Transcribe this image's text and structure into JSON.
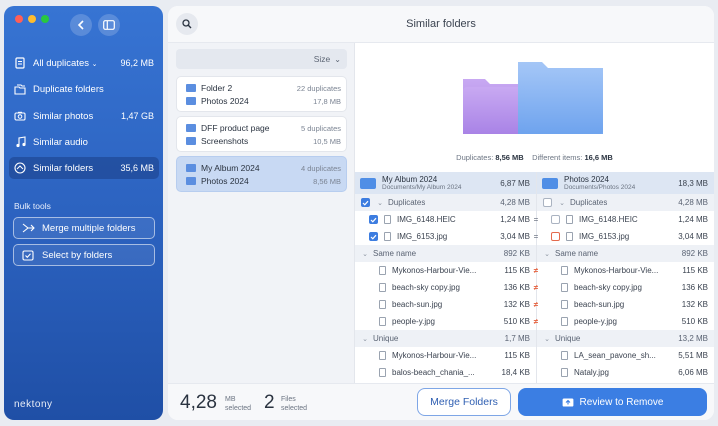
{
  "sidebar": {
    "items": [
      {
        "label": "All duplicates",
        "size": "96,2 MB",
        "icon": "files-icon"
      },
      {
        "label": "Duplicate folders",
        "size": "",
        "icon": "folders-icon"
      },
      {
        "label": "Similar photos",
        "size": "1,47 GB",
        "icon": "camera-icon"
      },
      {
        "label": "Similar audio",
        "size": "",
        "icon": "music-icon"
      },
      {
        "label": "Similar folders",
        "size": "35,6 MB",
        "icon": "similar-folders-icon"
      }
    ],
    "bulk_label": "Bulk tools",
    "merge_multiple": "Merge multiple folders",
    "select_by_folders": "Select by folders",
    "brand": "nektony"
  },
  "header": {
    "title": "Similar folders"
  },
  "list": {
    "sort_label": "Size",
    "cards": [
      {
        "top": "Folder 2",
        "top_meta": "22 duplicates",
        "bottom": "Photos 2024",
        "bottom_meta": "17,8 MB"
      },
      {
        "top": "DFF product page",
        "top_meta": "5 duplicates",
        "bottom": "Screenshots",
        "bottom_meta": "10,5 MB"
      },
      {
        "top": "My Album 2024",
        "top_meta": "4 duplicates",
        "bottom": "Photos 2024",
        "bottom_meta": "8,56 MB"
      }
    ]
  },
  "preview": {
    "duplicates_label": "Duplicates:",
    "duplicates_value": "8,56 MB",
    "different_label": "Different items:",
    "different_value": "16,6 MB"
  },
  "compare": {
    "left": {
      "folder": "My Album 2024",
      "path": "Documents/My Album 2024",
      "size": "6,87 MB",
      "rows": [
        {
          "kind": "grp",
          "label": "Duplicates",
          "size": "4,28 MB",
          "check": "on",
          "chev": "v"
        },
        {
          "kind": "file",
          "label": "IMG_6148.HEIC",
          "size": "1,24 MB",
          "check": "on"
        },
        {
          "kind": "file",
          "label": "IMG_6153.jpg",
          "size": "3,04 MB",
          "check": "on"
        },
        {
          "kind": "grp",
          "label": "Same name",
          "size": "892 KB",
          "chev": "v"
        },
        {
          "kind": "file",
          "label": "Mykonos-Harbour-Vie...",
          "size": "115 KB"
        },
        {
          "kind": "file",
          "label": "beach-sky copy.jpg",
          "size": "136 KB"
        },
        {
          "kind": "file",
          "label": "beach-sun.jpg",
          "size": "132 KB"
        },
        {
          "kind": "file",
          "label": "people-y.jpg",
          "size": "510 KB"
        },
        {
          "kind": "grp",
          "label": "Unique",
          "size": "1,7 MB",
          "chev": "v"
        },
        {
          "kind": "file",
          "label": "Mykonos-Harbour-Vie...",
          "size": "115 KB"
        },
        {
          "kind": "file",
          "label": "balos-beach_chania_...",
          "size": "18,4 KB"
        }
      ]
    },
    "right": {
      "folder": "Photos 2024",
      "path": "Documents/Photos 2024",
      "size": "18,3 MB",
      "rows": [
        {
          "kind": "grp",
          "label": "Duplicates",
          "size": "4,28 MB",
          "check": "off",
          "chev": "v"
        },
        {
          "kind": "file",
          "label": "IMG_6148.HEIC",
          "size": "1,24 MB",
          "check": "off"
        },
        {
          "kind": "file",
          "label": "IMG_6153.jpg",
          "size": "3,04 MB",
          "check": "warn"
        },
        {
          "kind": "grp",
          "label": "Same name",
          "size": "892 KB",
          "chev": "v"
        },
        {
          "kind": "file",
          "label": "Mykonos-Harbour-Vie...",
          "size": "115 KB"
        },
        {
          "kind": "file",
          "label": "beach-sky copy.jpg",
          "size": "136 KB"
        },
        {
          "kind": "file",
          "label": "beach-sun.jpg",
          "size": "132 KB"
        },
        {
          "kind": "file",
          "label": "people-y.jpg",
          "size": "510 KB"
        },
        {
          "kind": "grp",
          "label": "Unique",
          "size": "13,2 MB",
          "chev": "v"
        },
        {
          "kind": "file",
          "label": "LA_sean_pavone_sh...",
          "size": "5,51 MB"
        },
        {
          "kind": "file",
          "label": "Nataly.jpg",
          "size": "6,06 MB"
        }
      ]
    },
    "markers": [
      "",
      "=",
      "=",
      "",
      "≠",
      "≠",
      "≠",
      "≠",
      "",
      "",
      ""
    ]
  },
  "footer": {
    "size_value": "4,28",
    "size_unit": "MB",
    "size_caption": "selected",
    "files_value": "2",
    "files_unit": "Files",
    "files_caption": "selected",
    "merge_label": "Merge Folders",
    "review_label": "Review to Remove"
  },
  "colors": {
    "accent": "#3b7ee3",
    "sidebar": "#2b61be",
    "mismatch": "#e5613e"
  }
}
